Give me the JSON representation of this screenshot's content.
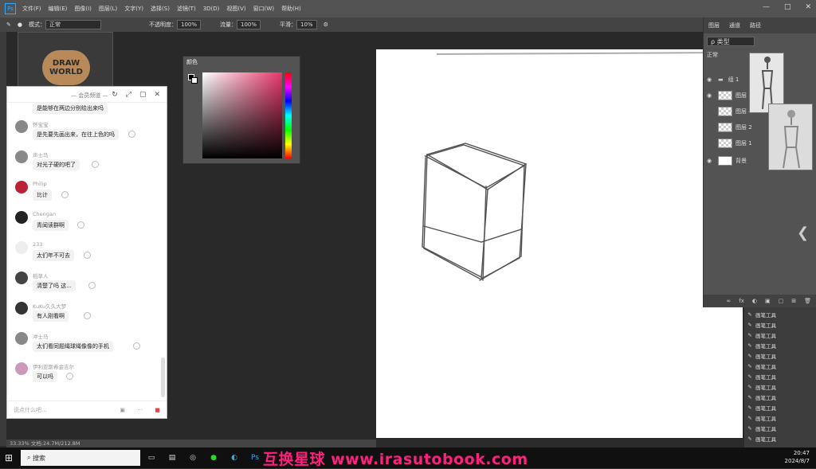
{
  "menubar": {
    "logo": "Ps",
    "items": [
      "文件(F)",
      "编辑(E)",
      "图像(I)",
      "图层(L)",
      "文字(Y)",
      "选择(S)",
      "滤镜(T)",
      "3D(D)",
      "视图(V)",
      "窗口(W)",
      "帮助(H)"
    ],
    "window_buttons": [
      "—",
      "□",
      "✕"
    ]
  },
  "optbar": {
    "mode_label": "模式：",
    "mode_value": "正常",
    "opacity_label": "不透明度：",
    "opacity_value": "100%",
    "flow_label": "流量：",
    "flow_value": "100%",
    "smooth_label": "平滑：",
    "smooth_value": "10%"
  },
  "doc": {
    "thumb_text": "DRAW WORLD",
    "status": "33.33%    文档:24.7M/212.8M"
  },
  "colorpanel": {
    "tab": "颜色"
  },
  "chat": {
    "header_title": "— 会员频道 —",
    "header_icons": [
      "↻",
      "⤢",
      "▢",
      "✕"
    ],
    "messages": [
      {
        "name": "",
        "text": "是能够在两边分别绘出来吗"
      },
      {
        "name": "怀宝宝",
        "text": "是先要先画出来，在往上色的吗"
      },
      {
        "name": "声士马",
        "text": "对光子硬的吧了"
      },
      {
        "name": "Philip",
        "text": "比计"
      },
      {
        "name": "Chengan",
        "text": "青闻读群啊"
      },
      {
        "name": "233",
        "text": "太们年不可去"
      },
      {
        "name": "稻草人",
        "text": "清楚了吗 这..."
      },
      {
        "name": "KuKu久久大梦",
        "text": "有人刚看啊"
      },
      {
        "name": "冲士马",
        "text": "太们看同题绳球绳像像的手机"
      },
      {
        "name": "伊利亚斯希金吉尔",
        "text": "可以吗"
      }
    ],
    "input_placeholder": "说点什么吧..."
  },
  "layers": {
    "tabs": [
      "图层",
      "通道",
      "路径"
    ],
    "filter_label": "ρ 类型",
    "blend_mode": "正常",
    "rows": [
      {
        "name": "组 1",
        "visible": true
      },
      {
        "name": "图层 3",
        "visible": true
      },
      {
        "name": "图层 4",
        "visible": false
      },
      {
        "name": "图层 2",
        "visible": false
      },
      {
        "name": "图层 1",
        "visible": false
      },
      {
        "name": "背景",
        "visible": true
      }
    ],
    "bottom_icons": [
      "∞",
      "fx",
      "◐",
      "▣",
      "▢",
      "⊞",
      "🗑"
    ]
  },
  "history": {
    "rows": [
      "画笔工具",
      "画笔工具",
      "画笔工具",
      "画笔工具",
      "画笔工具",
      "画笔工具",
      "画笔工具",
      "画笔工具",
      "画笔工具",
      "画笔工具",
      "画笔工具",
      "画笔工具",
      "画笔工具"
    ]
  },
  "taskbar": {
    "search_placeholder": "搜索",
    "clock_time": "20:47",
    "clock_date": "2024/8/7"
  },
  "watermark": "互换星球 www.irasutobook.com"
}
